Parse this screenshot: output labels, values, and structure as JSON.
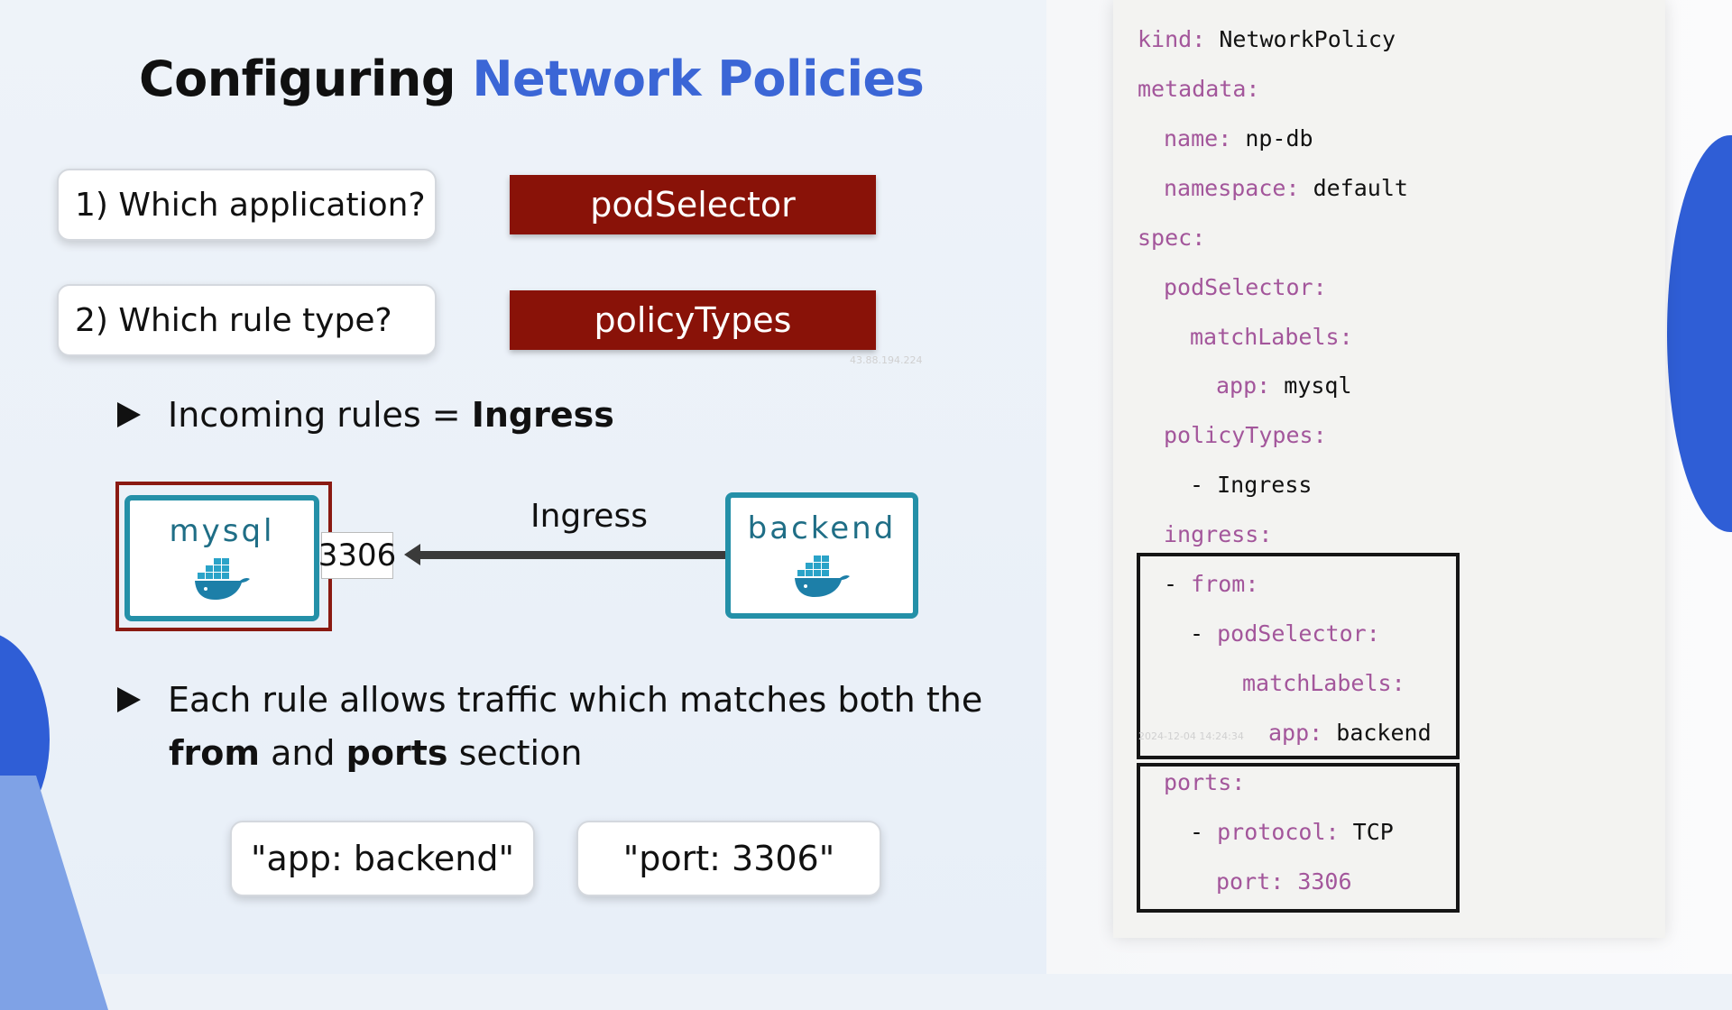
{
  "slide": {
    "title_main": "Configuring",
    "title_accent": "Network Policies",
    "questions": [
      {
        "label": "1) Which application?",
        "answer": "podSelector"
      },
      {
        "label": "2) Which rule type?",
        "answer": "policyTypes"
      }
    ],
    "bullet1": {
      "text": "Incoming rules = ",
      "bold": "Ingress"
    },
    "diagram": {
      "pod_left": "mysql",
      "pod_right": "backend",
      "port": "3306",
      "arrow_label": "Ingress"
    },
    "bullet2": {
      "line1": "Each rule allows traffic which matches both the",
      "bold_a": "from",
      "mid": " and ",
      "bold_b": "ports",
      "tail": " section"
    },
    "chips": [
      "\"app: backend\"",
      "\"port: 3306\""
    ],
    "watermarks": [
      "43.88.194.224",
      "2024-12-04 14:24:34"
    ]
  },
  "code": {
    "lines": [
      {
        "key": "kind",
        "value": "NetworkPolicy"
      },
      {
        "key": "metadata",
        "value": ""
      },
      {
        "key": "name",
        "value": "np-db"
      },
      {
        "key": "namespace",
        "value": "default"
      },
      {
        "key": "spec",
        "value": ""
      },
      {
        "key": "podSelector",
        "value": ""
      },
      {
        "key": "matchLabels",
        "value": ""
      },
      {
        "key": "app",
        "value": "mysql"
      },
      {
        "key": "policyTypes",
        "value": ""
      },
      {
        "key": "- Ingress",
        "value": ""
      },
      {
        "key": "ingress",
        "value": ""
      },
      {
        "key": "from",
        "value": ""
      },
      {
        "key": "podSelector",
        "value": ""
      },
      {
        "key": "matchLabels",
        "value": ""
      },
      {
        "key": "app",
        "value": "backend"
      },
      {
        "key": "ports",
        "value": ""
      },
      {
        "key": "protocol",
        "value": "TCP"
      },
      {
        "key": "port",
        "value": "3306"
      }
    ]
  }
}
